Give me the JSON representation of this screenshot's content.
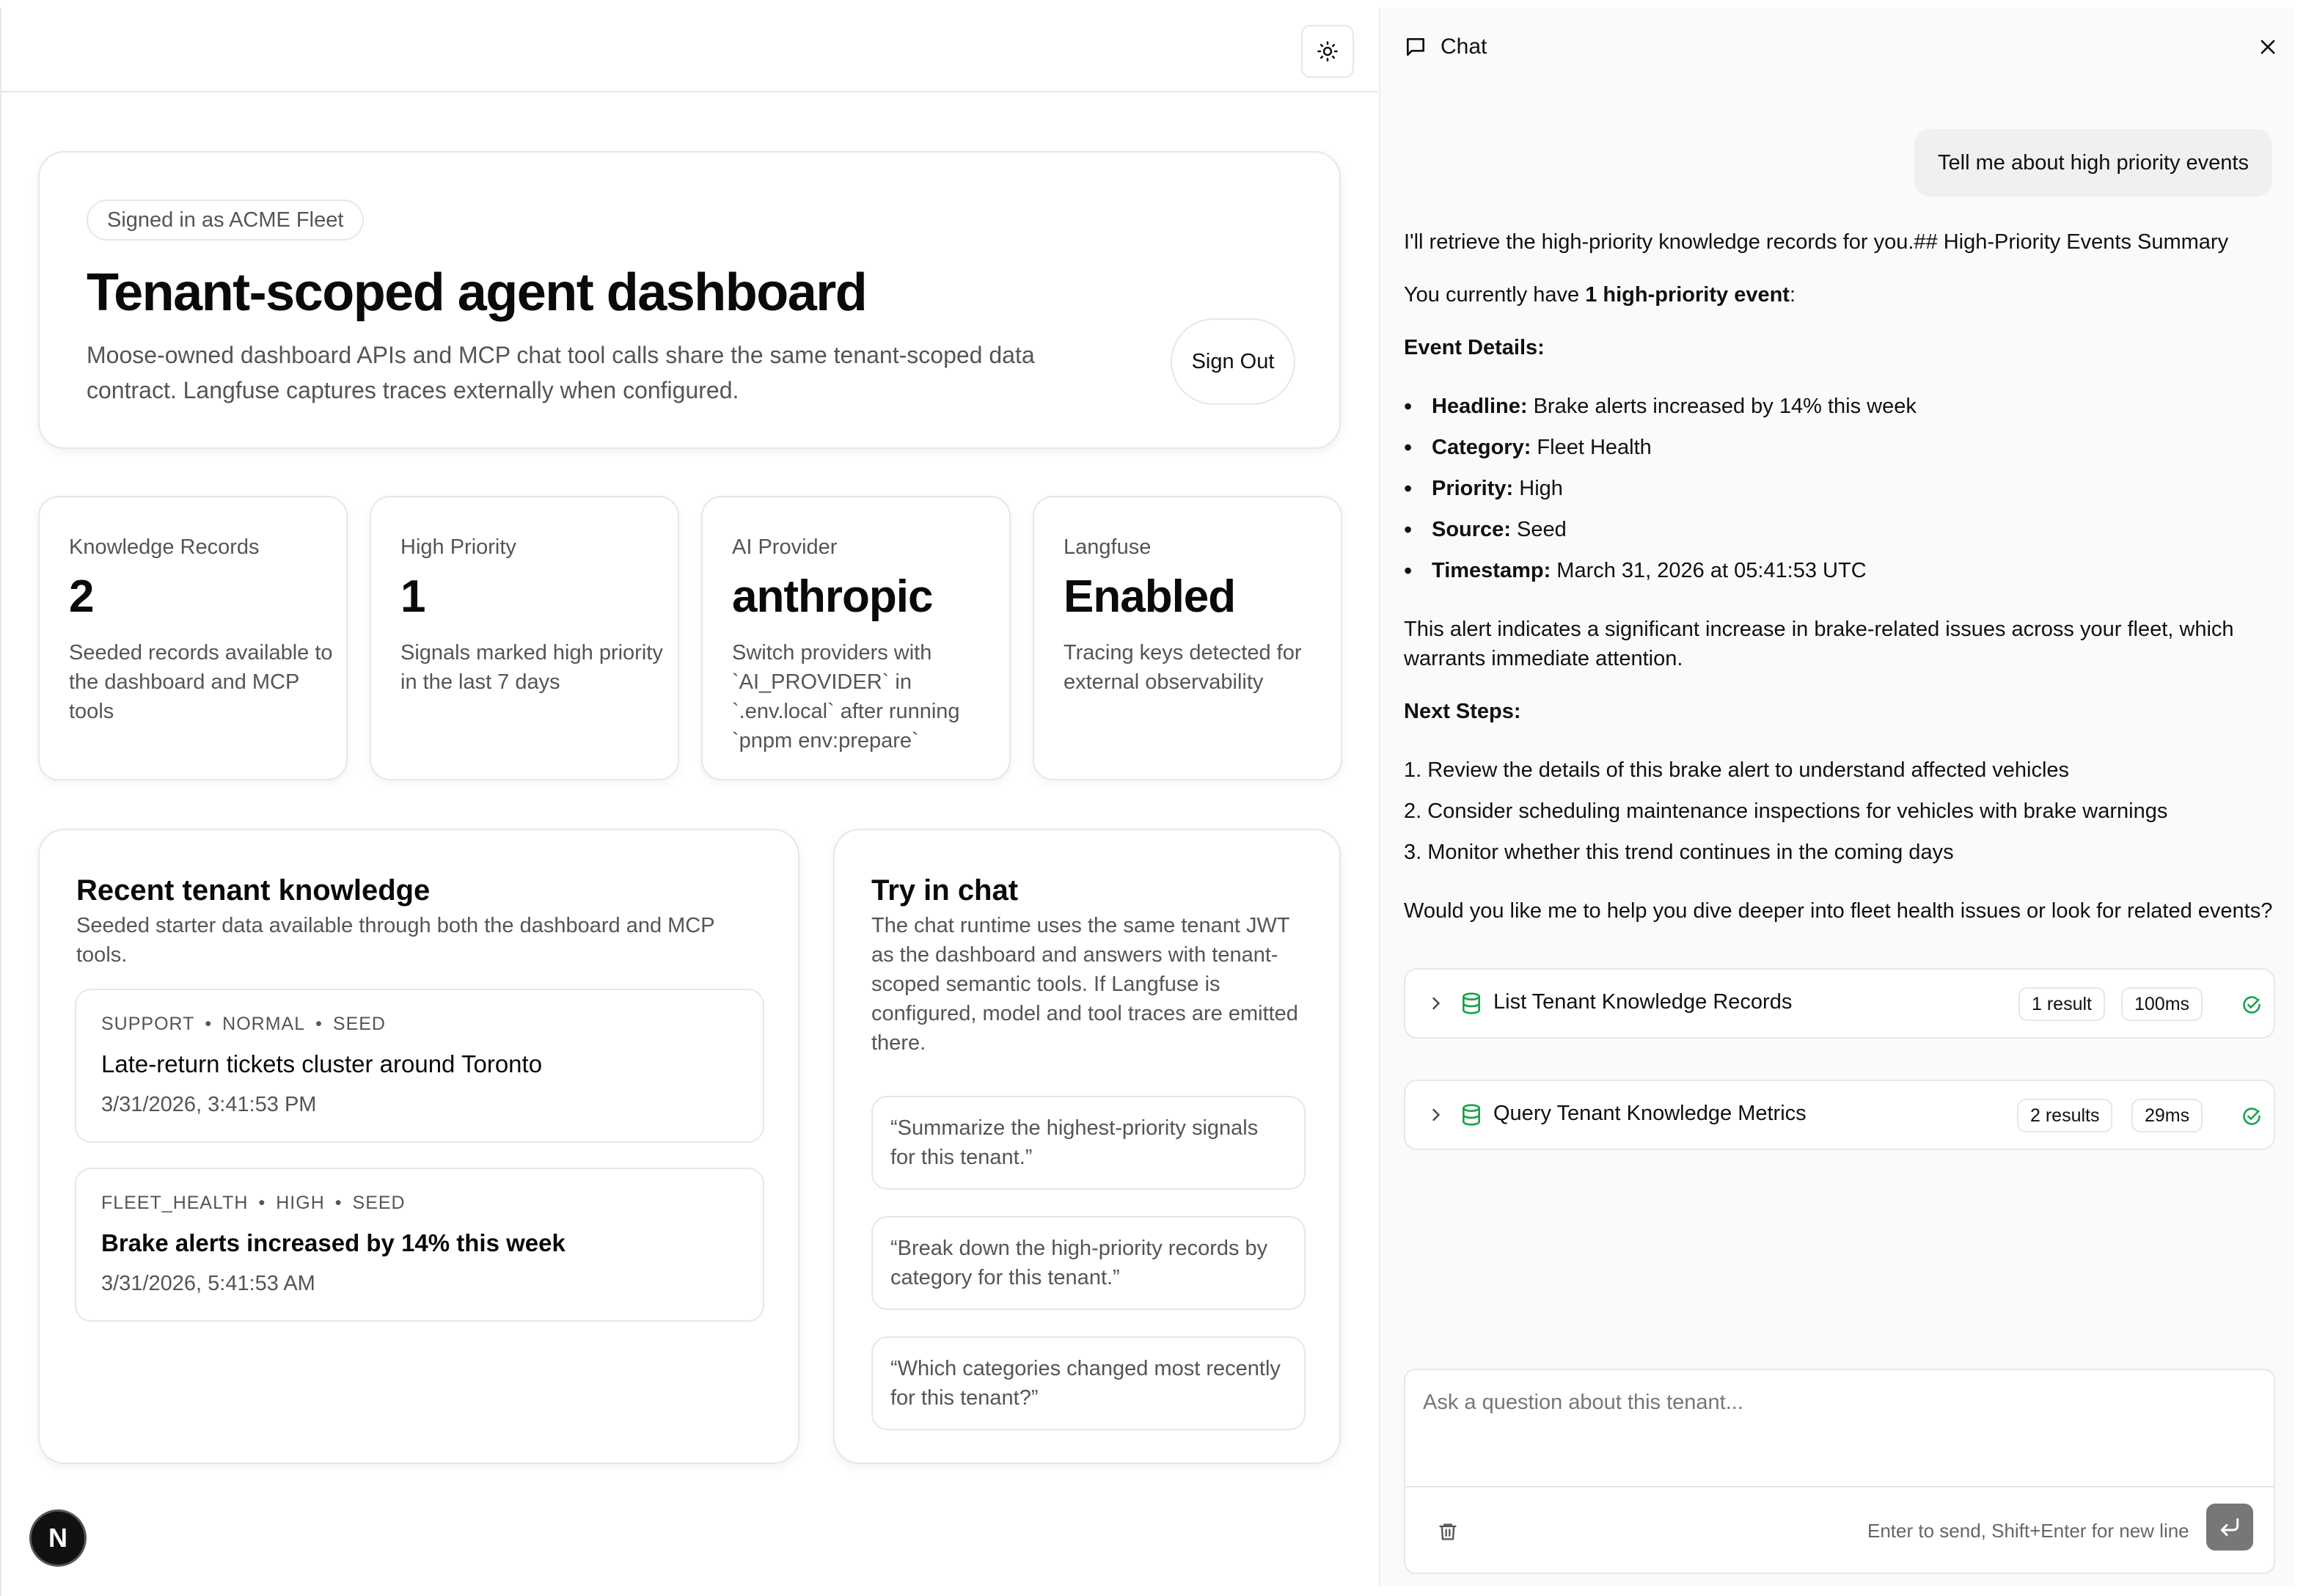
{
  "dashboard": {
    "signed_in_badge": "Signed in as ACME Fleet",
    "title": "Tenant-scoped agent dashboard",
    "description": "Moose-owned dashboard APIs and MCP chat tool calls share the same tenant-scoped data contract. Langfuse captures traces externally when configured.",
    "sign_out_label": "Sign Out",
    "theme_icon": "sun-icon"
  },
  "stats": [
    {
      "label": "Knowledge Records",
      "value": "2",
      "description": "Seeded records available to the dashboard and MCP tools"
    },
    {
      "label": "High Priority",
      "value": "1",
      "description": "Signals marked high priority in the last 7 days"
    },
    {
      "label": "AI Provider",
      "value": "anthropic",
      "description": "Switch providers with `AI_PROVIDER` in `.env.local` after running `pnpm env:prepare`"
    },
    {
      "label": "Langfuse",
      "value": "Enabled",
      "description": "Tracing keys detected for external observability"
    }
  ],
  "recent": {
    "title": "Recent tenant knowledge",
    "description": "Seeded starter data available through both the dashboard and MCP tools.",
    "items": [
      {
        "category": "SUPPORT",
        "priority": "NORMAL",
        "source": "SEED",
        "title": "Late-return tickets cluster around Toronto",
        "date": "3/31/2026, 3:41:53 PM"
      },
      {
        "category": "FLEET_HEALTH",
        "priority": "HIGH",
        "source": "SEED",
        "title": "Brake alerts increased by 14% this week",
        "date": "3/31/2026, 5:41:53 AM"
      }
    ]
  },
  "try_chat": {
    "title": "Try in chat",
    "description": "The chat runtime uses the same tenant JWT as the dashboard and answers with tenant-scoped semantic tools. If Langfuse is configured, model and tool traces are emitted there.",
    "prompts": [
      "“Summarize the highest-priority signals for this tenant.”",
      "“Break down the high-priority records by category for this tenant.”",
      "“Which categories changed most recently for this tenant?”"
    ]
  },
  "framework_badge": "N",
  "chat": {
    "title": "Chat",
    "user_message": "Tell me about high priority events",
    "assistant": {
      "intro": "I'll retrieve the high-priority knowledge records for you.## High-Priority Events Summary",
      "count_prefix": "You currently have ",
      "count_bold": "1 high-priority event",
      "count_suffix": ":",
      "details_heading": "Event Details:",
      "details": [
        {
          "key": "Headline:",
          "value": " Brake alerts increased by 14% this week"
        },
        {
          "key": "Category:",
          "value": " Fleet Health"
        },
        {
          "key": "Priority:",
          "value": " High"
        },
        {
          "key": "Source:",
          "value": " Seed"
        },
        {
          "key": "Timestamp:",
          "value": " March 31, 2026 at 05:41:53 UTC"
        }
      ],
      "alert_line1": "This alert indicates a significant increase in brake-related issues across your fleet, which",
      "alert_line2": "warrants immediate attention.",
      "next_heading": "Next Steps:",
      "steps": [
        "1. Review the details of this brake alert to understand affected vehicles",
        "2. Consider scheduling maintenance inspections for vehicles with brake warnings",
        "3. Monitor whether this trend continues in the coming days"
      ],
      "closing": "Would you like me to help you dive deeper into fleet health issues or look for related events?"
    },
    "tools": [
      {
        "name": "List Tenant Knowledge Records",
        "results": "1 result",
        "duration": "100ms"
      },
      {
        "name": "Query Tenant Knowledge Metrics",
        "results": "2 results",
        "duration": "29ms"
      }
    ],
    "input_placeholder": "Ask a question about this tenant...",
    "hint": "Enter to send, Shift+Enter for new line"
  },
  "colors": {
    "success": "#16a34a",
    "border": "#e5e7eb",
    "muted_text": "#555555"
  }
}
